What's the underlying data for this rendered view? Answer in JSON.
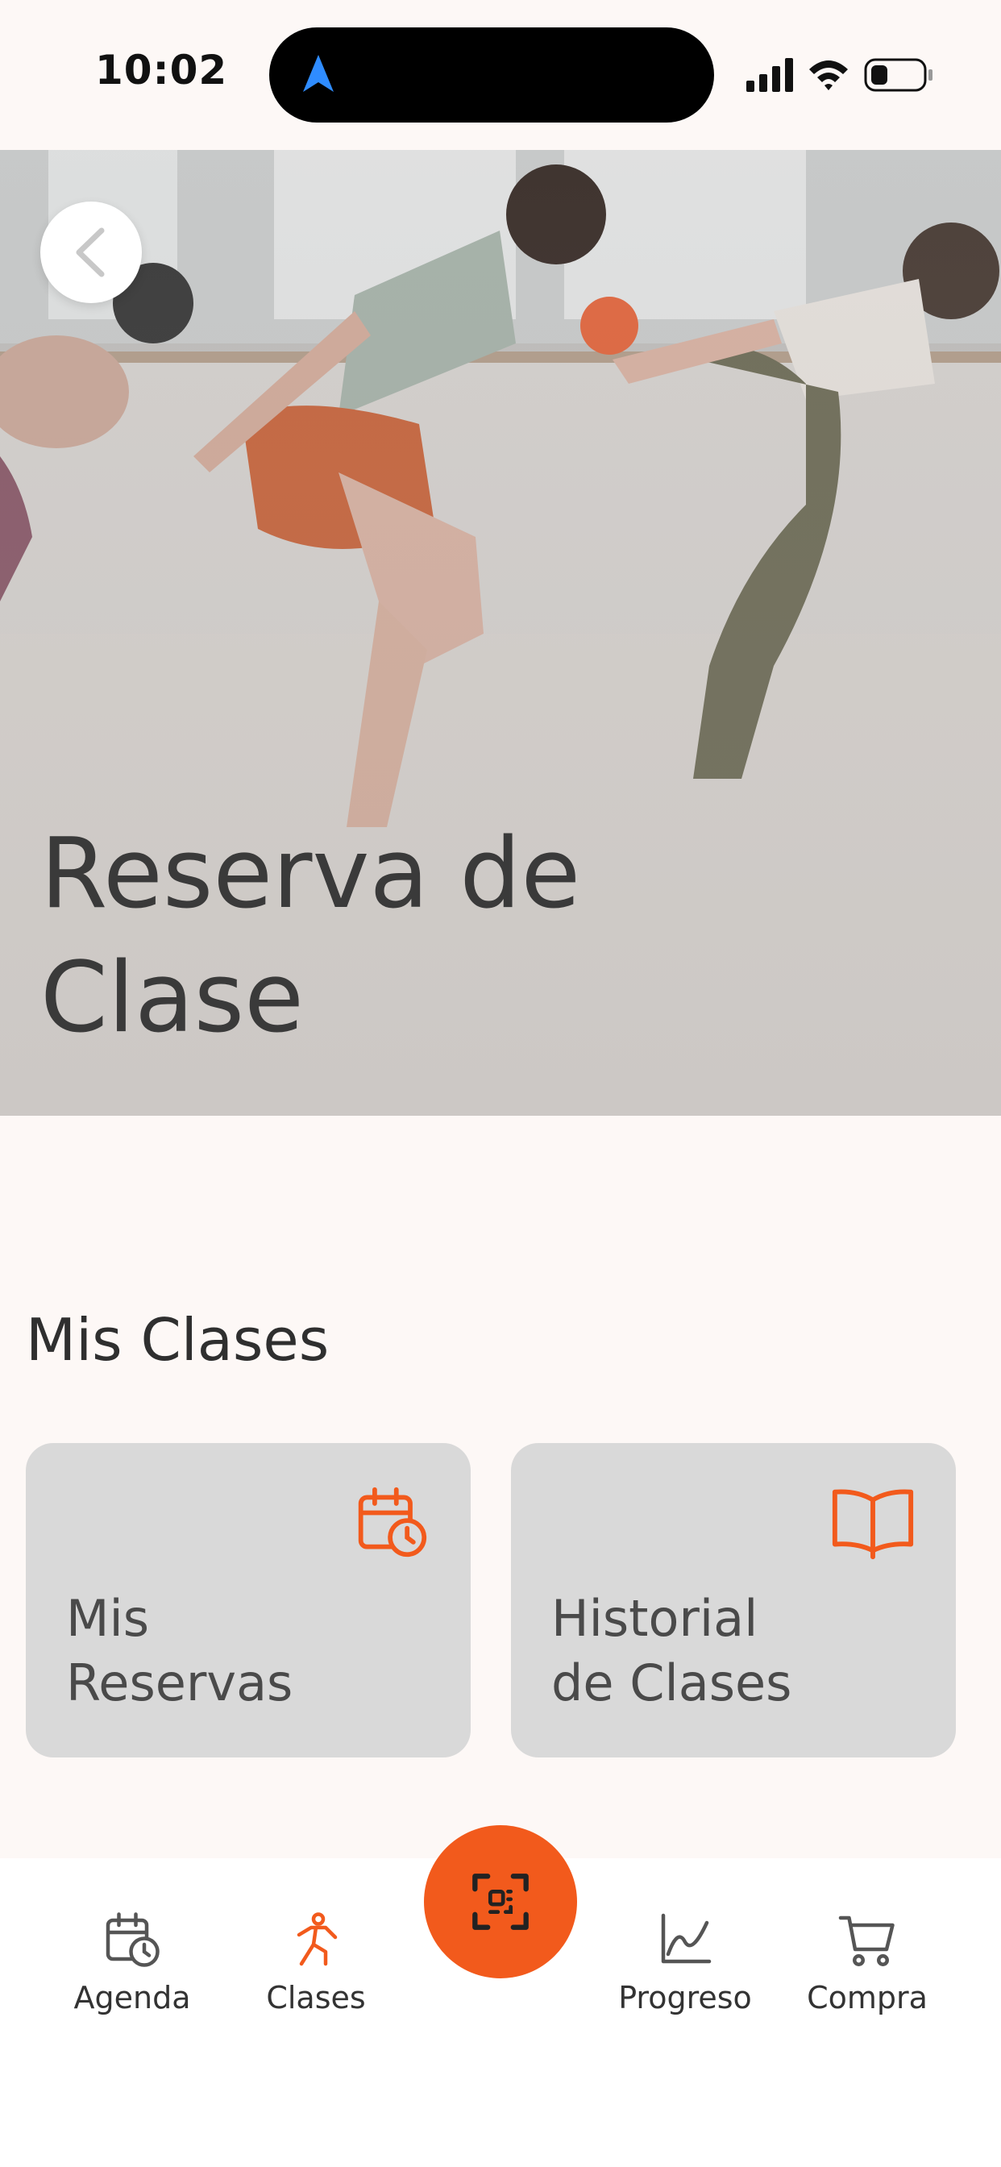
{
  "status_bar": {
    "time": "10:02"
  },
  "hero": {
    "title_line1": "Reserva de",
    "title_line2": "Clase"
  },
  "section": {
    "title": "Mis Clases"
  },
  "cards": [
    {
      "label_line1": "Mis",
      "label_line2": "Reservas",
      "icon": "calendar-clock-icon"
    },
    {
      "label_line1": "Historial",
      "label_line2": "de Clases",
      "icon": "book-open-icon"
    }
  ],
  "bottom_nav": {
    "items": [
      {
        "label": "Agenda",
        "icon": "calendar-clock-icon"
      },
      {
        "label": "Clases",
        "icon": "running-person-icon",
        "active": true
      },
      {
        "label": "Progreso",
        "icon": "line-chart-icon"
      },
      {
        "label": "Compra",
        "icon": "shopping-cart-icon"
      }
    ],
    "center_icon": "scan-icon"
  },
  "colors": {
    "accent": "#f25a1c",
    "background": "#fdf8f6",
    "card": "#d9d9d9",
    "text": "#333333"
  }
}
